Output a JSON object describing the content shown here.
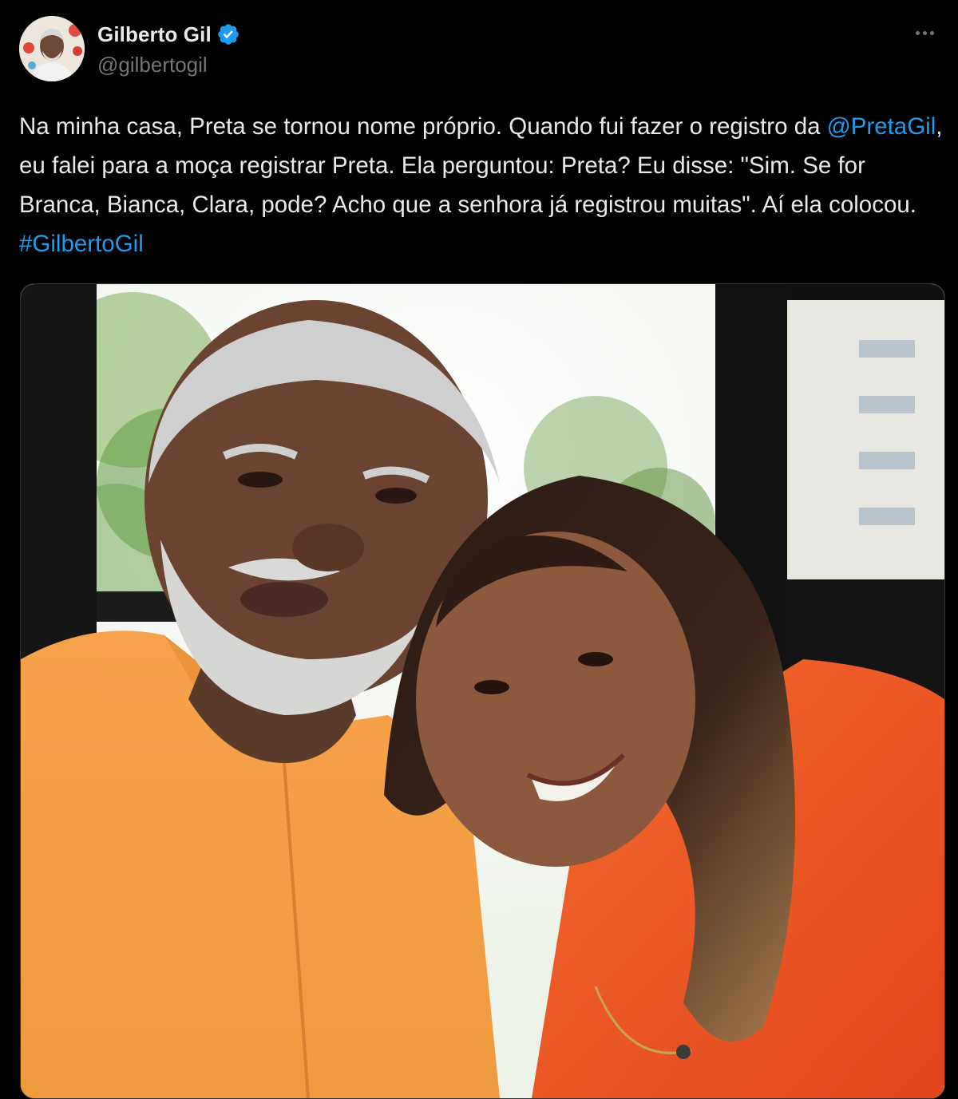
{
  "author": {
    "display_name": "Gilberto Gil",
    "handle": "@gilbertogil",
    "verified": true,
    "verified_icon": "verified-badge-icon",
    "avatar_icon": "avatar-photo"
  },
  "menu": {
    "more_icon": "more-options-icon"
  },
  "tweet": {
    "text_part1": "Na minha casa, Preta se tornou nome próprio. Quando fui fazer o registro da ",
    "mention": "@PretaGil",
    "text_part2": ", eu falei para a moça registrar Preta. Ela perguntou: Preta? Eu disse: \"Sim. Se for Branca, Bianca, Clara, pode? Acho que a senhora já registrou muitas\". Aí ela colocou. ",
    "hashtag": "#GilbertoGil"
  },
  "media": {
    "type": "photo"
  },
  "colors": {
    "background": "#000000",
    "text": "#e7e9ea",
    "secondary_text": "#71767b",
    "link": "#1d9bf0",
    "verified": "#1d9bf0"
  }
}
